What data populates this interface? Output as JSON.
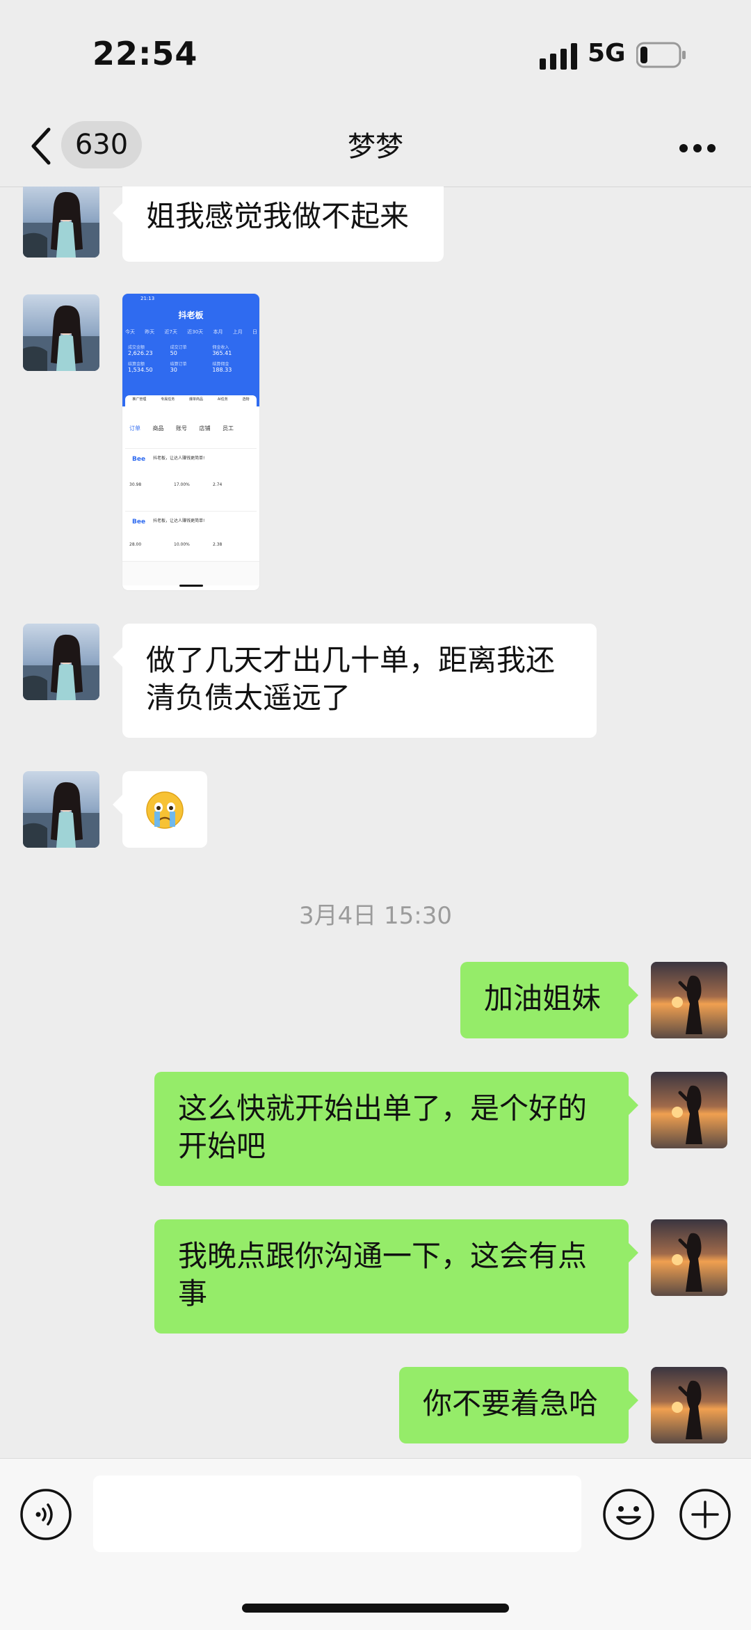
{
  "status_bar": {
    "time": "22:54",
    "network": "5G"
  },
  "header": {
    "unread_count": "630",
    "title": "梦梦"
  },
  "messages": [
    {
      "side": "in",
      "type": "text",
      "text": "姐我感觉我做不起来"
    },
    {
      "side": "in",
      "type": "image",
      "screenshot": {
        "status": "21:13",
        "title": "抖老板",
        "tabs": [
          "今天",
          "昨天",
          "近7天",
          "近30天",
          "本月",
          "上月",
          "日"
        ],
        "stats": [
          {
            "label": "成交金额",
            "value": "2,626.23"
          },
          {
            "label": "成交订单",
            "value": "50"
          },
          {
            "label": "佣金收入",
            "value": "365.41"
          },
          {
            "label": "结算金额",
            "value": "1,534.50"
          },
          {
            "label": "结算订单",
            "value": "30"
          },
          {
            "label": "结算佣金",
            "value": "188.33"
          }
        ],
        "menu": [
          "推广管理",
          "专属任务",
          "爆单商品",
          "AI任务",
          "选物"
        ],
        "subtabs": [
          "订单",
          "商品",
          "账号",
          "店铺",
          "员工"
        ],
        "orders": [
          {
            "text": "抖老板，让达人赚钱更简单!",
            "amount": "30.98",
            "rate": "17.00%",
            "comm": "2.74"
          },
          {
            "text": "抖老板，让达人赚钱更简单!",
            "amount": "28.00",
            "rate": "10.00%",
            "comm": "2.38"
          }
        ]
      }
    },
    {
      "side": "in",
      "type": "text",
      "text": "做了几天才出几十单，距离我还清负债太遥远了"
    },
    {
      "side": "in",
      "type": "emoji",
      "text": "😢"
    },
    {
      "type": "timestamp",
      "text": "3月4日 15:30"
    },
    {
      "side": "out",
      "type": "text",
      "text": "加油姐妹"
    },
    {
      "side": "out",
      "type": "text",
      "text": "这么快就开始出单了，是个好的开始吧"
    },
    {
      "side": "out",
      "type": "text",
      "text": "我晚点跟你沟通一下，这会有点事"
    },
    {
      "side": "out",
      "type": "text",
      "text": "你不要着急哈"
    }
  ],
  "input": {
    "placeholder": ""
  },
  "icons": {
    "back": "chevron-left-icon",
    "more": "more-icon",
    "voice": "voice-icon",
    "emoji": "emoji-icon",
    "plus": "plus-icon"
  },
  "colors": {
    "outgoing_bubble": "#95ec69",
    "incoming_bubble": "#ffffff",
    "background": "#ededed"
  }
}
